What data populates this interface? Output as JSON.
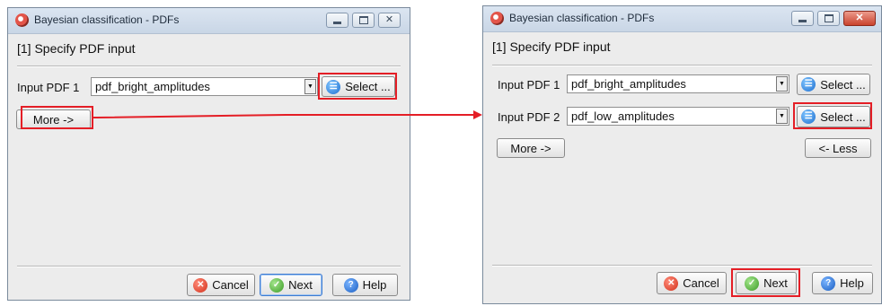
{
  "left_window": {
    "title": "Bayesian classification - PDFs",
    "heading": "[1] Specify PDF input",
    "input1_label": "Input PDF 1",
    "input1_value": "pdf_bright_amplitudes",
    "select_label": "Select ...",
    "more_label": "More ->",
    "cancel_label": "Cancel",
    "next_label": "Next",
    "help_label": "Help"
  },
  "right_window": {
    "title": "Bayesian classification - PDFs",
    "heading": "[1] Specify PDF input",
    "input1_label": "Input PDF 1",
    "input1_value": "pdf_bright_amplitudes",
    "input2_label": "Input PDF 2",
    "input2_value": "pdf_low_amplitudes",
    "select_label": "Select ...",
    "more_label": "More ->",
    "less_label": "<- Less",
    "cancel_label": "Cancel",
    "next_label": "Next",
    "help_label": "Help"
  },
  "colors": {
    "highlight": "#e41e26",
    "arrow": "#e41e26"
  },
  "icons": {
    "app": "bayesian-app-icon",
    "select": "select-list-icon",
    "cancel": "cancel-x-icon",
    "next": "next-check-icon",
    "help": "help-question-icon"
  }
}
